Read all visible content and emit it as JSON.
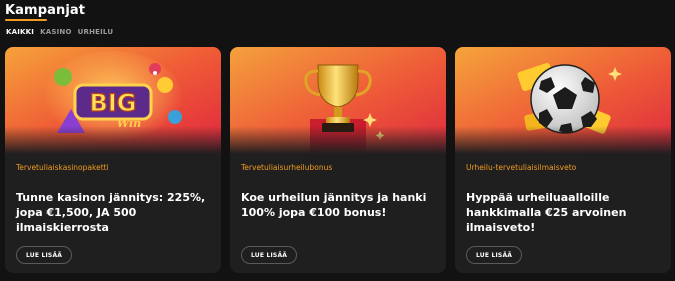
{
  "header": {
    "title": "Kampanjat"
  },
  "tabs": [
    {
      "label": "KAIKKI",
      "active": true
    },
    {
      "label": "KASINO",
      "active": false
    },
    {
      "label": "URHEILU",
      "active": false
    }
  ],
  "cards": [
    {
      "category": "Tervetuliaiskasinopaketti",
      "headline": "Tunne kasinon jännitys: 225%, jopa €1,500, JA 500 ilmaiskierrosta",
      "button_label": "LUE LISÄÄ",
      "hero_logo_text": "BIG Win",
      "hero_icon": "big-win-slot-logo"
    },
    {
      "category": "Tervetuliaisurheilubonus",
      "headline": "Koe urheilun jännitys ja hanki 100% jopa €100 bonus!",
      "button_label": "LUE LISÄÄ",
      "hero_icon": "gold-trophy"
    },
    {
      "category": "Urheilu-tervetuliaisilmaisveto",
      "headline": "Hyppää urheiluaalloille hankkimalla €25 arvoinen ilmaisveto!",
      "button_label": "LUE LISÄÄ",
      "hero_icon": "soccer-ball-with-tickets"
    }
  ],
  "colors": {
    "accent": "#f39c1f",
    "background": "#121212",
    "card": "#1f1f1f"
  }
}
